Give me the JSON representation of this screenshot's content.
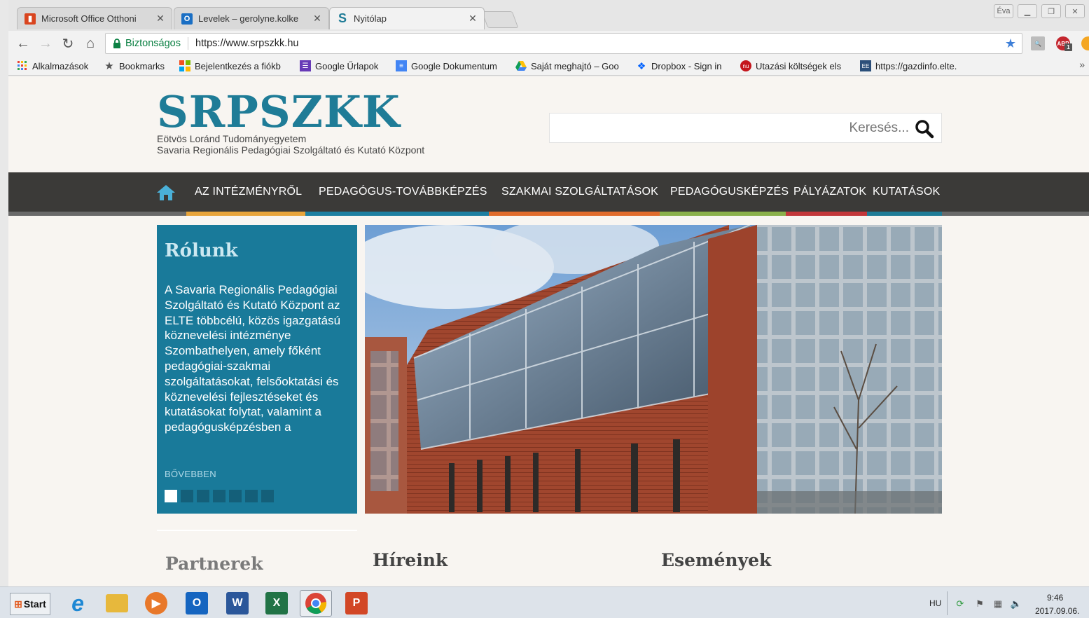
{
  "browser": {
    "tabs": [
      {
        "title": "Microsoft Office Otthoni",
        "icon": "office-icon",
        "color": "#d9451f"
      },
      {
        "title": "Levelek – gerolyne.kolke",
        "icon": "outlook-icon",
        "color": "#1a6fc4"
      },
      {
        "title": "Nyitólap",
        "icon": "srpszkk-favicon",
        "color": "#1f7c97"
      }
    ],
    "window_user": "Éva",
    "address": {
      "secure_label": "Biztonságos",
      "url": "https://www.srpszkk.hu"
    },
    "bookmarks": [
      {
        "label": "Alkalmazások",
        "icon": "apps-grid-icon"
      },
      {
        "label": "Bookmarks",
        "icon": "star-icon"
      },
      {
        "label": "Bejelentkezés a fiókb",
        "icon": "microsoft-icon"
      },
      {
        "label": "Google Űrlapok",
        "icon": "google-forms-icon"
      },
      {
        "label": "Google Dokumentum",
        "icon": "google-docs-icon"
      },
      {
        "label": "Saját meghajtó – Goo",
        "icon": "google-drive-icon"
      },
      {
        "label": "Dropbox - Sign in",
        "icon": "dropbox-icon"
      },
      {
        "label": "Utazási költségek els",
        "icon": "nu-icon"
      },
      {
        "label": "https://gazdinfo.elte.",
        "icon": "gazdinfo-icon"
      }
    ],
    "extensions": {
      "abp_badge": "1"
    }
  },
  "site": {
    "logo": "SRPSZKK",
    "subtitle_1": "Eötvös Loránd Tudományegyetem",
    "subtitle_2": "Savaria Regionális Pedagógiai Szolgáltató és Kutató Központ",
    "search": {
      "placeholder": "Keresés..."
    },
    "menu": [
      {
        "label": "AZ INTÉZMÉNYRŐL",
        "stripe": "#e8a43a"
      },
      {
        "label": "PEDAGÓGUS-TOVÁBBKÉPZÉS",
        "stripe": "#1d7fa1"
      },
      {
        "label": "SZAKMAI SZOLGÁLTATÁSOK",
        "stripe": "#e06b2c"
      },
      {
        "label": "PEDAGÓGUSKÉPZÉS",
        "stripe": "#8ab04a"
      },
      {
        "label": "PÁLYÁZATOK",
        "stripe": "#c2373a"
      },
      {
        "label": "KUTATÁSOK",
        "stripe": "#1f7c97"
      }
    ],
    "about": {
      "title": "Rólunk",
      "text": "A Savaria Regionális Pedagógiai Szolgáltató és Kutató Központ az ELTE többcélú, közös igazgatású köznevelési intézménye Szombathelyen, amely főként pedagógiai-szakmai szolgáltatásokat, felsőoktatási és köznevelési fejlesztéseket és kutatásokat folytat, valamint a pedagógusképzésben a",
      "more": "BŐVEBBEN",
      "slide_count": 7,
      "active_slide": 0
    },
    "sections": {
      "partners": "Partnerek",
      "news": "Híreink",
      "events": "Események"
    }
  },
  "taskbar": {
    "start": "Start",
    "apps": [
      {
        "name": "internet-explorer-icon",
        "letter": "e",
        "color": "#1e88d4"
      },
      {
        "name": "file-explorer-icon",
        "letter": "",
        "color": "#e7b83c"
      },
      {
        "name": "media-player-icon",
        "letter": "▶",
        "color": "#e8782a"
      },
      {
        "name": "outlook-icon",
        "letter": "O",
        "color": "#1565c0"
      },
      {
        "name": "word-icon",
        "letter": "W",
        "color": "#2b579a"
      },
      {
        "name": "excel-icon",
        "letter": "X",
        "color": "#217346"
      },
      {
        "name": "chrome-icon",
        "letter": "",
        "color": "#db4437"
      },
      {
        "name": "powerpoint-icon",
        "letter": "P",
        "color": "#d24726"
      }
    ],
    "lang": "HU",
    "time": "9:46",
    "date": "2017.09.06."
  }
}
